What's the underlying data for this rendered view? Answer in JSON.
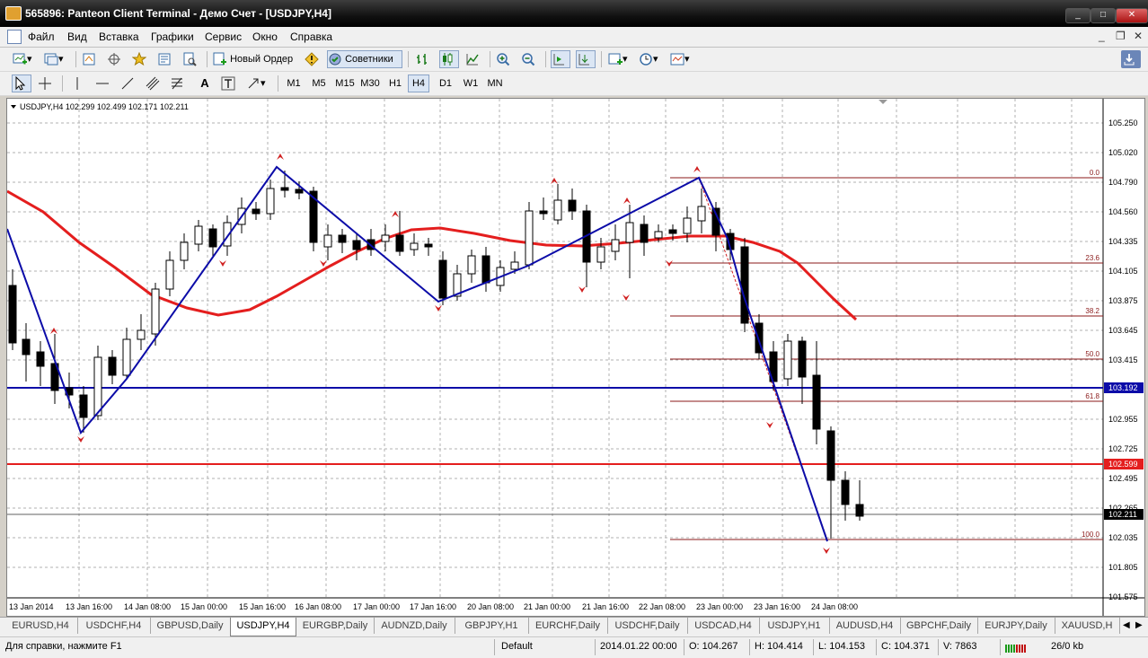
{
  "window": {
    "title": "565896: Panteon Client Terminal - Демо Счет - [USDJPY,H4]"
  },
  "menu": [
    "Файл",
    "Вид",
    "Вставка",
    "Графики",
    "Сервис",
    "Окно",
    "Справка"
  ],
  "toolbar": {
    "new_order": "Новый Ордер",
    "advisors": "Советники"
  },
  "tools": {
    "text_tool": "A"
  },
  "timeframes": [
    "M1",
    "M5",
    "M15",
    "M30",
    "H1",
    "H4",
    "D1",
    "W1",
    "MN"
  ],
  "active_timeframe": "H4",
  "chart": {
    "info": "USDJPY,H4  102.299 102.499 102.171 102.211",
    "price_labels": [
      "105.250",
      "105.020",
      "104.790",
      "104.560",
      "104.335",
      "104.105",
      "103.875",
      "103.645",
      "103.415",
      "103.192",
      "102.955",
      "102.725",
      "102.495",
      "102.265",
      "102.035",
      "101.805",
      "101.575"
    ],
    "time_labels": [
      "13 Jan 2014",
      "13 Jan 16:00",
      "14 Jan 08:00",
      "15 Jan 00:00",
      "15 Jan 16:00",
      "16 Jan 08:00",
      "17 Jan 00:00",
      "17 Jan 16:00",
      "20 Jan 08:00",
      "21 Jan 00:00",
      "21 Jan 16:00",
      "22 Jan 08:00",
      "23 Jan 00:00",
      "23 Jan 16:00",
      "24 Jan 08:00"
    ],
    "hline_blue": "103.192",
    "hline_red": "102.599",
    "current_price": "102.211",
    "fib_levels": [
      "0.0",
      "23.6",
      "38.2",
      "50.0",
      "61.8",
      "100.0"
    ],
    "colors": {
      "bull": "#ffffff",
      "bear": "#000000",
      "ma": "#e41e1e",
      "zigzag": "#0c0ca8",
      "fib": "#8b1a1a",
      "grid": "#c0c0c0"
    }
  },
  "tabs": [
    "EURUSD,H4",
    "USDCHF,H4",
    "GBPUSD,Daily",
    "USDJPY,H4",
    "EURGBP,Daily",
    "AUDNZD,Daily",
    "GBPJPY,H1",
    "EURCHF,Daily",
    "USDCHF,Daily",
    "USDCAD,H4",
    "USDJPY,H1",
    "AUDUSD,H4",
    "GBPCHF,Daily",
    "EURJPY,Daily",
    "XAUUSD,H"
  ],
  "active_tab": "USDJPY,H4",
  "status": {
    "help": "Для справки, нажмите F1",
    "profile": "Default",
    "datetime": "2014.01.22 00:00",
    "open": "O: 104.267",
    "high": "H: 104.414",
    "low": "L: 104.153",
    "close": "C: 104.371",
    "volume": "V: 7863",
    "traffic": "26/0 kb"
  }
}
